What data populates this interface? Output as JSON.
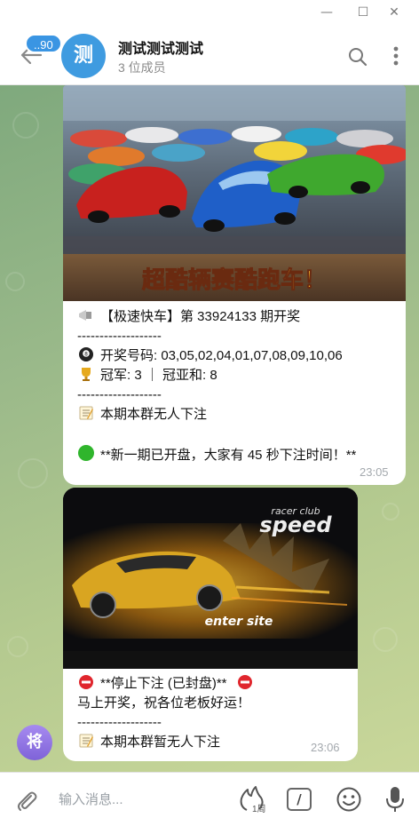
{
  "window": {
    "minimize_glyph": "—",
    "maximize_glyph": "☐",
    "close_glyph": "✕"
  },
  "header": {
    "unread_badge": "..90",
    "avatar_letter": "测",
    "title": "测试测试测试",
    "subtitle": "3 位成员",
    "icons": [
      "back-arrow-icon",
      "search-icon",
      "more-vertical-icon"
    ]
  },
  "messages": [
    {
      "image": "race-cars-banner",
      "lines": [
        {
          "icon": "megaphone-icon",
          "text": "【极速快车】第 33924133 期开奖"
        },
        {
          "icon": "",
          "text": "-------------------"
        },
        {
          "icon": "8-ball-icon",
          "text": "开奖号码: 03,05,02,04,01,07,08,09,10,06"
        },
        {
          "icon": "trophy-icon",
          "text": "冠军: 3 ｜ 冠亚和: 8"
        },
        {
          "icon": "",
          "text": "-------------------"
        },
        {
          "icon": "memo-icon",
          "text": "本期本群无人下注"
        },
        {
          "icon": "",
          "text": ""
        },
        {
          "icon": "green-circle-icon",
          "text": "**新一期已开盘，大家有 45 秒下注时间！**"
        }
      ],
      "time": "23:05",
      "banner_text": "超酷辆赛酷跑车！"
    },
    {
      "image": "speed-racer-car",
      "lines": [
        {
          "icon": "no-entry-icon",
          "text": "**停止下注 (已封盘)**",
          "icon_after": "no-entry-icon"
        },
        {
          "icon": "",
          "text": "马上开奖，祝各位老板好运！"
        },
        {
          "icon": "",
          "text": "-------------------"
        },
        {
          "icon": "memo-icon",
          "text": "本期本群暂无人下注"
        }
      ],
      "time": "23:06",
      "banner_brand": "speed",
      "banner_brand_top": "racer club",
      "banner_sub": "enter site"
    }
  ],
  "sender_avatar": {
    "letter": "将"
  },
  "input": {
    "placeholder": "输入消息...",
    "fire_label": "1周",
    "command_glyph": "/"
  },
  "colors": {
    "accent": "#3a95e3",
    "avatar": "#3f9be0",
    "sender_avatar": "#8d70e0",
    "time": "#a4a9ae"
  }
}
